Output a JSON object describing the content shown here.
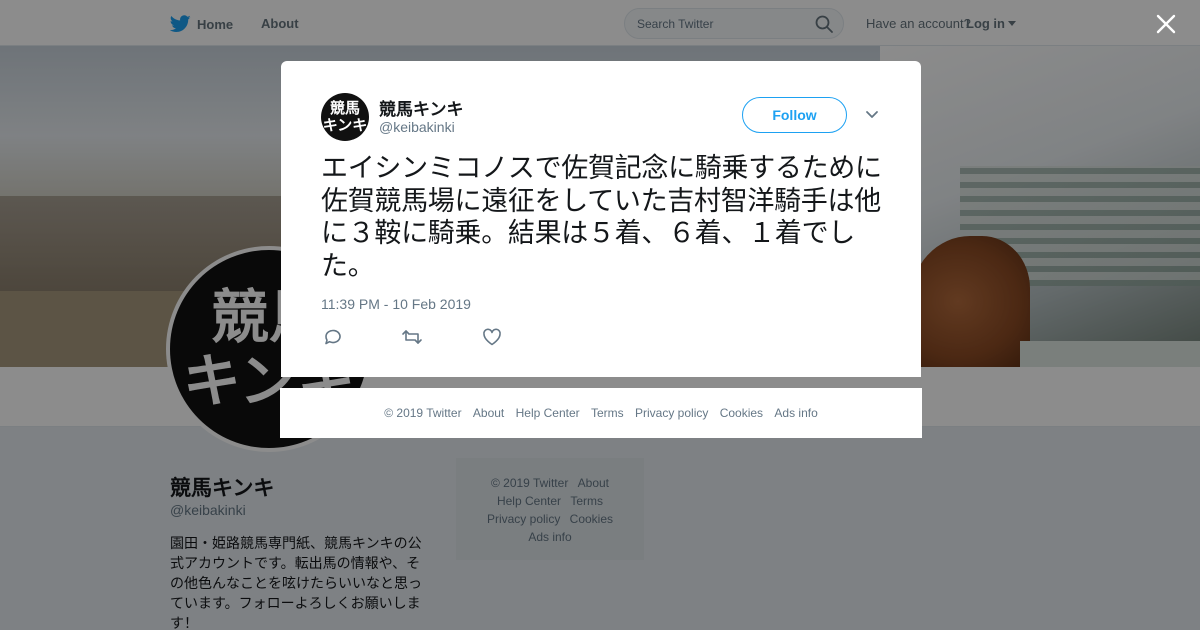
{
  "topbar": {
    "home_label": "Home",
    "about_label": "About",
    "search_placeholder": "Search Twitter",
    "account_prompt": "Have an account?",
    "login_label": "Log in"
  },
  "profile": {
    "name": "競馬キンキ",
    "handle": "@keibakinki",
    "avatar_text_line1": "競馬",
    "avatar_text_line2": "キンキ",
    "bio": "園田・姫路競馬専門紙、競馬キンキの公式アカウントです。転出馬の情報や、その他色んなことを呟けたらいいなと思っています。フォローよろしくお願いします！"
  },
  "side_footer": {
    "copyright": "© 2019 Twitter",
    "about": "About",
    "help": "Help Center",
    "terms": "Terms",
    "privacy": "Privacy policy",
    "cookies": "Cookies",
    "ads": "Ads info"
  },
  "tweet": {
    "author_name": "競馬キンキ",
    "author_handle": "@keibakinki",
    "follow_label": "Follow",
    "text": "エイシンミコノスで佐賀記念に騎乗するために佐賀競馬場に遠征をしていた吉村智洋騎手は他に３鞍に騎乗。結果は５着、６着、１着でした。",
    "timestamp": "11:39 PM - 10 Feb 2019",
    "avatar_text_line1": "競馬",
    "avatar_text_line2": "キンキ"
  },
  "modal_footer": {
    "copyright": "© 2019 Twitter",
    "about": "About",
    "help": "Help Center",
    "terms": "Terms",
    "privacy": "Privacy policy",
    "cookies": "Cookies",
    "ads": "Ads info"
  },
  "icons": {
    "brand": "twitter-bird-icon",
    "search": "search-icon",
    "close": "close-icon",
    "reply": "reply-icon",
    "retweet": "retweet-icon",
    "like": "heart-icon",
    "more": "chevron-down-icon"
  },
  "colors": {
    "accent": "#1da1f2",
    "text": "#14171a",
    "muted": "#657786"
  }
}
